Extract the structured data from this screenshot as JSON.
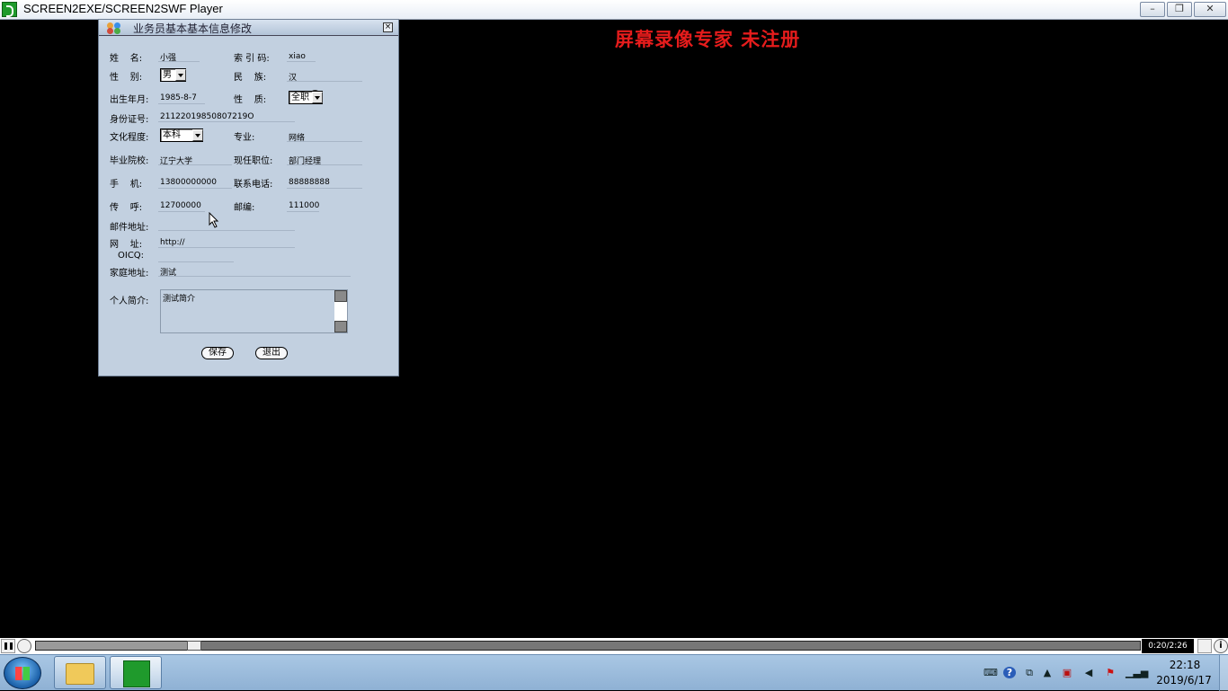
{
  "player": {
    "title": "SCREEN2EXE/SCREEN2SWF Player",
    "minimize": "–",
    "maximize": "❐",
    "close": "✕",
    "watermark": "屏幕录像专家  未注册",
    "time_current": "0:20",
    "time_total": "2:26",
    "timecode": "0:20/2:26",
    "progress": 0.137
  },
  "dialog": {
    "title": "业务员基本基本信息修改",
    "close_glyph": "×",
    "fields": {
      "name_label": "姓    名:",
      "name_value": "小强",
      "index_code_label": "索 引 码:",
      "index_code_value": "xiao",
      "gender_label": "性    别:",
      "gender_value": "男",
      "ethnicity_label": "民    族:",
      "ethnicity_value": "汉",
      "birth_label": "出生年月:",
      "birth_value": "1985-8-7",
      "nature_label": "性    质:",
      "nature_value": "全职",
      "id_label": "身份证号:",
      "id_value": "21122019850807219O",
      "education_label": "文化程度:",
      "education_value": "本科",
      "major_label": "专业:",
      "major_value": "网络",
      "school_label": "毕业院校:",
      "school_value": "辽宁大学",
      "position_label": "现任职位:",
      "position_value": "部门经理",
      "mobile_label": "手    机:",
      "mobile_value": "13800000000",
      "phone_label": "联系电话:",
      "phone_value": "88888888",
      "pager_label": "传    呼:",
      "pager_value": "12700000",
      "zip_label": "邮编:",
      "zip_value": "111000",
      "email_label": "邮件地址:",
      "email_value": "",
      "website_label": "网    址:",
      "website_value": "http://",
      "oicq_label": "OICQ:",
      "oicq_value": "",
      "address_label": "家庭地址:",
      "address_value": "测试",
      "intro_label": "个人简介:",
      "intro_value": "测试简介"
    },
    "buttons": {
      "save": "保存",
      "exit": "退出"
    }
  },
  "taskbar": {
    "clock_time": "22:18",
    "clock_date": "2019/6/17",
    "tray_icons": [
      "keyboard-icon",
      "help-icon",
      "network-icon",
      "up-arrow-icon",
      "security-icon",
      "volume-icon",
      "flag-icon",
      "signal-icon"
    ]
  },
  "colors": {
    "watermark": "#e51c1c",
    "dialog_bg": "#c2d0e0",
    "taskbar": "#a9c7e4"
  }
}
